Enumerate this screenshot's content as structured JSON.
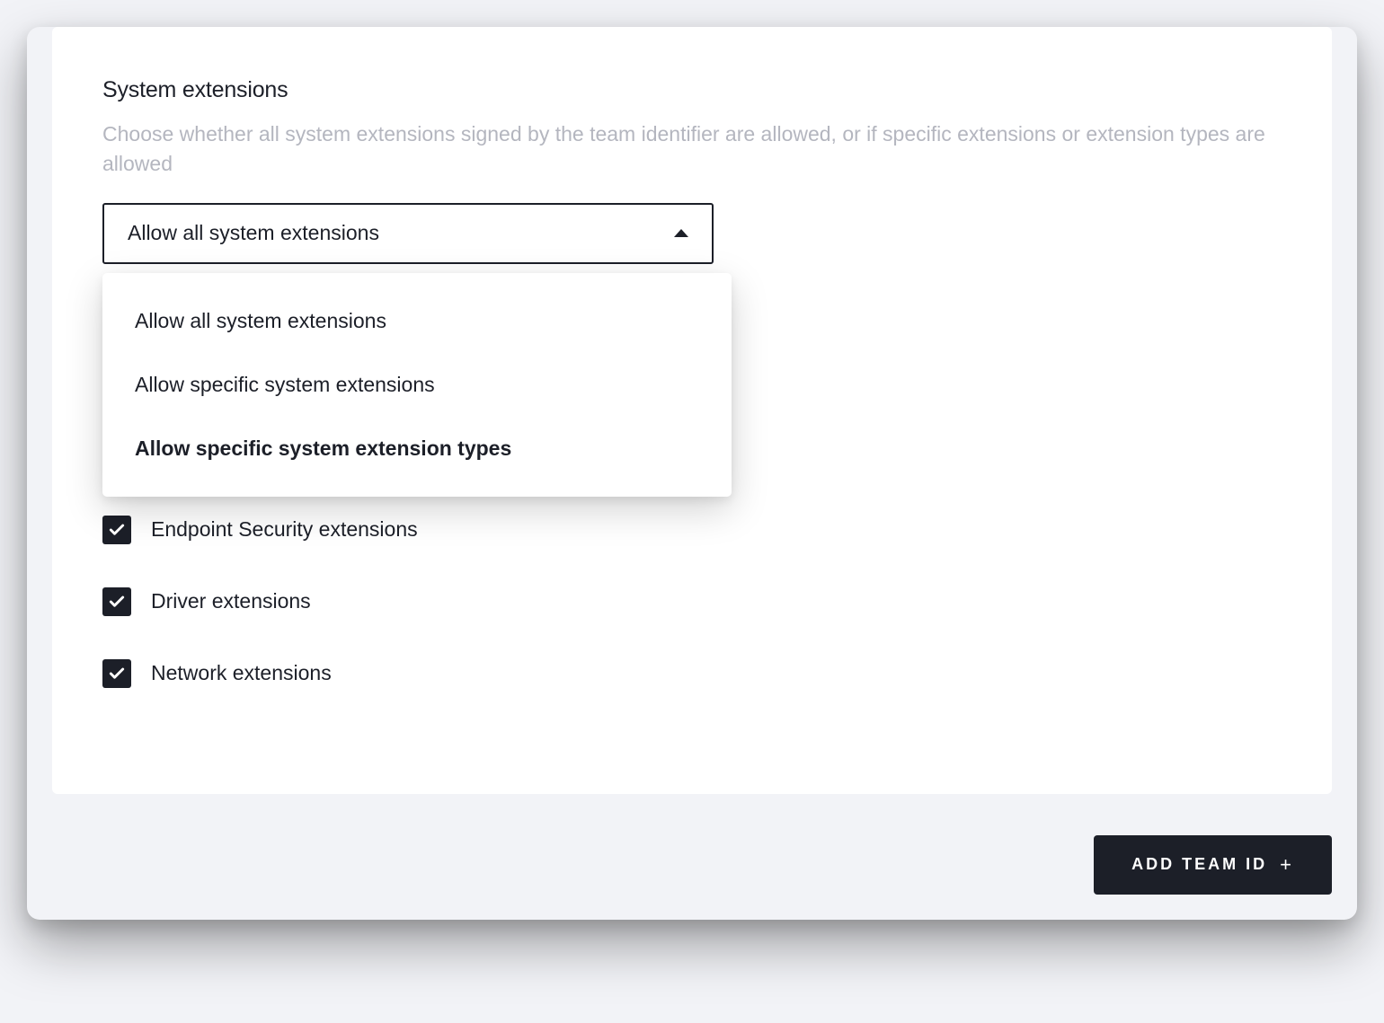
{
  "section": {
    "title": "System extensions",
    "description": "Choose whether all system extensions signed by the team identifier are allowed, or if specific extensions or extension types are allowed"
  },
  "select": {
    "value": "Allow all system extensions",
    "options": [
      {
        "label": "Allow all system extensions",
        "bold": false
      },
      {
        "label": "Allow specific system extensions",
        "bold": false
      },
      {
        "label": "Allow specific system extension types",
        "bold": true
      }
    ]
  },
  "checkboxes": [
    {
      "label": "Endpoint Security extensions",
      "checked": true
    },
    {
      "label": "Driver extensions",
      "checked": true
    },
    {
      "label": "Network extensions",
      "checked": true
    }
  ],
  "footer": {
    "add_button_label": "ADD TEAM ID"
  }
}
